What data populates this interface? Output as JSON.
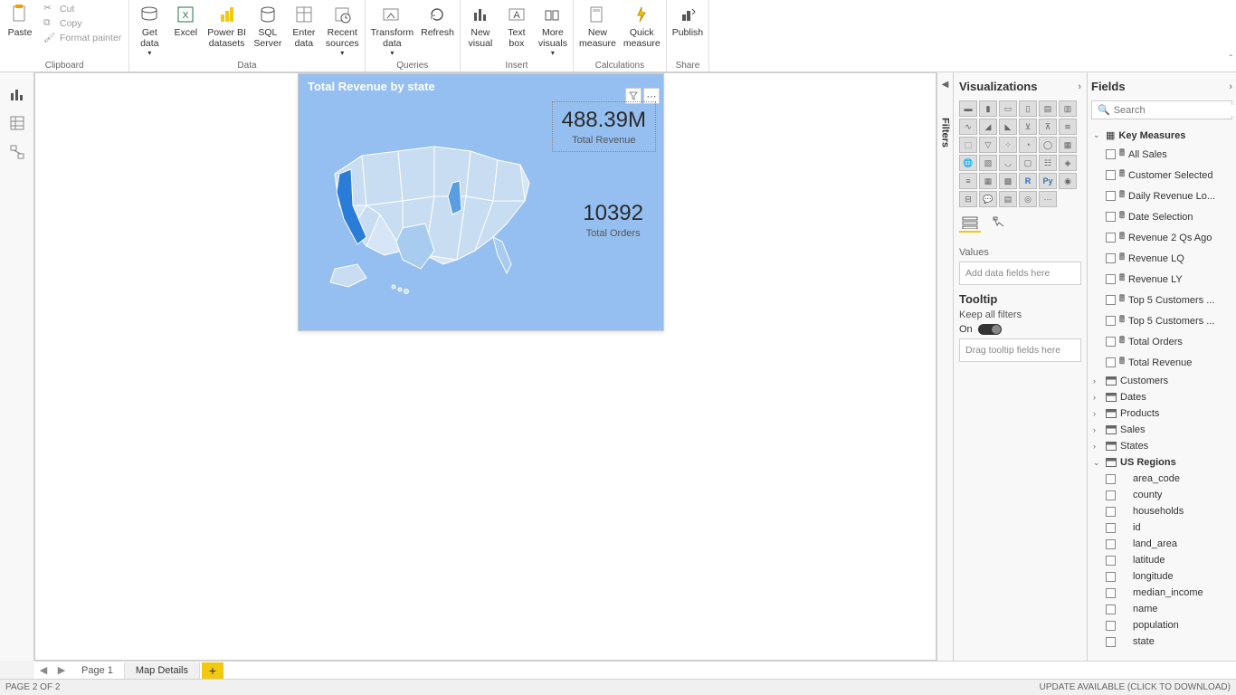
{
  "ribbon": {
    "clipboard": {
      "label": "Clipboard",
      "paste": "Paste",
      "cut": "Cut",
      "copy": "Copy",
      "format": "Format painter"
    },
    "data": {
      "label": "Data",
      "getdata": "Get\ndata",
      "excel": "Excel",
      "pbids": "Power BI\ndatasets",
      "sql": "SQL\nServer",
      "enter": "Enter\ndata",
      "recent": "Recent\nsources"
    },
    "queries": {
      "label": "Queries",
      "transform": "Transform\ndata",
      "refresh": "Refresh"
    },
    "insert": {
      "label": "Insert",
      "newvis": "New\nvisual",
      "textbox": "Text\nbox",
      "more": "More\nvisuals"
    },
    "calc": {
      "label": "Calculations",
      "newmeas": "New\nmeasure",
      "quick": "Quick\nmeasure"
    },
    "share": {
      "label": "Share",
      "publish": "Publish"
    }
  },
  "visual": {
    "title": "Total Revenue by state",
    "card1_value": "488.39M",
    "card1_label": "Total Revenue",
    "card2_value": "10392",
    "card2_label": "Total Orders"
  },
  "viz_panel": {
    "header": "Visualizations",
    "values": "Values",
    "values_placeholder": "Add data fields here",
    "tooltip": "Tooltip",
    "keepfilters": "Keep all filters",
    "on": "On",
    "tooltip_placeholder": "Drag tooltip fields here"
  },
  "fields_panel": {
    "header": "Fields",
    "search_placeholder": "Search",
    "tables": {
      "key_measures": {
        "name": "Key Measures",
        "expanded": true,
        "fields": [
          "All Sales",
          "Customer Selected",
          "Daily Revenue Lo...",
          "Date Selection",
          "Revenue 2 Qs Ago",
          "Revenue LQ",
          "Revenue LY",
          "Top 5 Customers ...",
          "Top 5 Customers ...",
          "Total Orders",
          "Total Revenue"
        ]
      },
      "customers": "Customers",
      "dates": "Dates",
      "products": "Products",
      "sales": "Sales",
      "states": "States",
      "us_regions": {
        "name": "US Regions",
        "expanded": true,
        "fields": [
          "area_code",
          "county",
          "households",
          "id",
          "land_area",
          "latitude",
          "longitude",
          "median_income",
          "name",
          "population",
          "state"
        ]
      }
    }
  },
  "filters_label": "Filters",
  "tabs": {
    "page1": "Page 1",
    "page2": "Map Details"
  },
  "status": {
    "left": "PAGE 2 OF 2",
    "right": "UPDATE AVAILABLE (CLICK TO DOWNLOAD)"
  }
}
